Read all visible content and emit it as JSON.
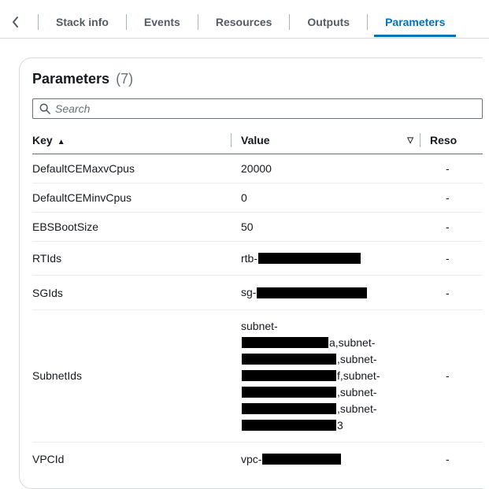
{
  "tabs": {
    "items": [
      {
        "label": "Stack info"
      },
      {
        "label": "Events"
      },
      {
        "label": "Resources"
      },
      {
        "label": "Outputs"
      },
      {
        "label": "Parameters"
      }
    ],
    "active_index": 4
  },
  "panel": {
    "title": "Parameters",
    "count": "(7)"
  },
  "search": {
    "placeholder": "Search"
  },
  "columns": {
    "key": "Key",
    "value": "Value",
    "resolved": "Reso"
  },
  "rows": [
    {
      "key": "DefaultCEMaxvCpus",
      "value_plain": "20000",
      "resolved": "-"
    },
    {
      "key": "DefaultCEMinvCpus",
      "value_plain": "0",
      "resolved": "-"
    },
    {
      "key": "EBSBootSize",
      "value_plain": "50",
      "resolved": "-"
    },
    {
      "key": "RTIds",
      "value_prefix": "rtb-",
      "redacted_width": "w130",
      "resolved": "-"
    },
    {
      "key": "SGIds",
      "value_prefix": "sg-",
      "redacted_width": "w140",
      "resolved": "-"
    },
    {
      "key": "SubnetIds",
      "subnet_block": true,
      "resolved": "-"
    },
    {
      "key": "VPCId",
      "value_prefix": "vpc-",
      "redacted_width": "w100",
      "resolved": "-"
    }
  ],
  "subnet_label": "subnet-",
  "subnet_suffixes": [
    "a,subnet-",
    ",subnet-",
    "f,subnet-",
    ",subnet-",
    ",subnet-",
    "3"
  ]
}
